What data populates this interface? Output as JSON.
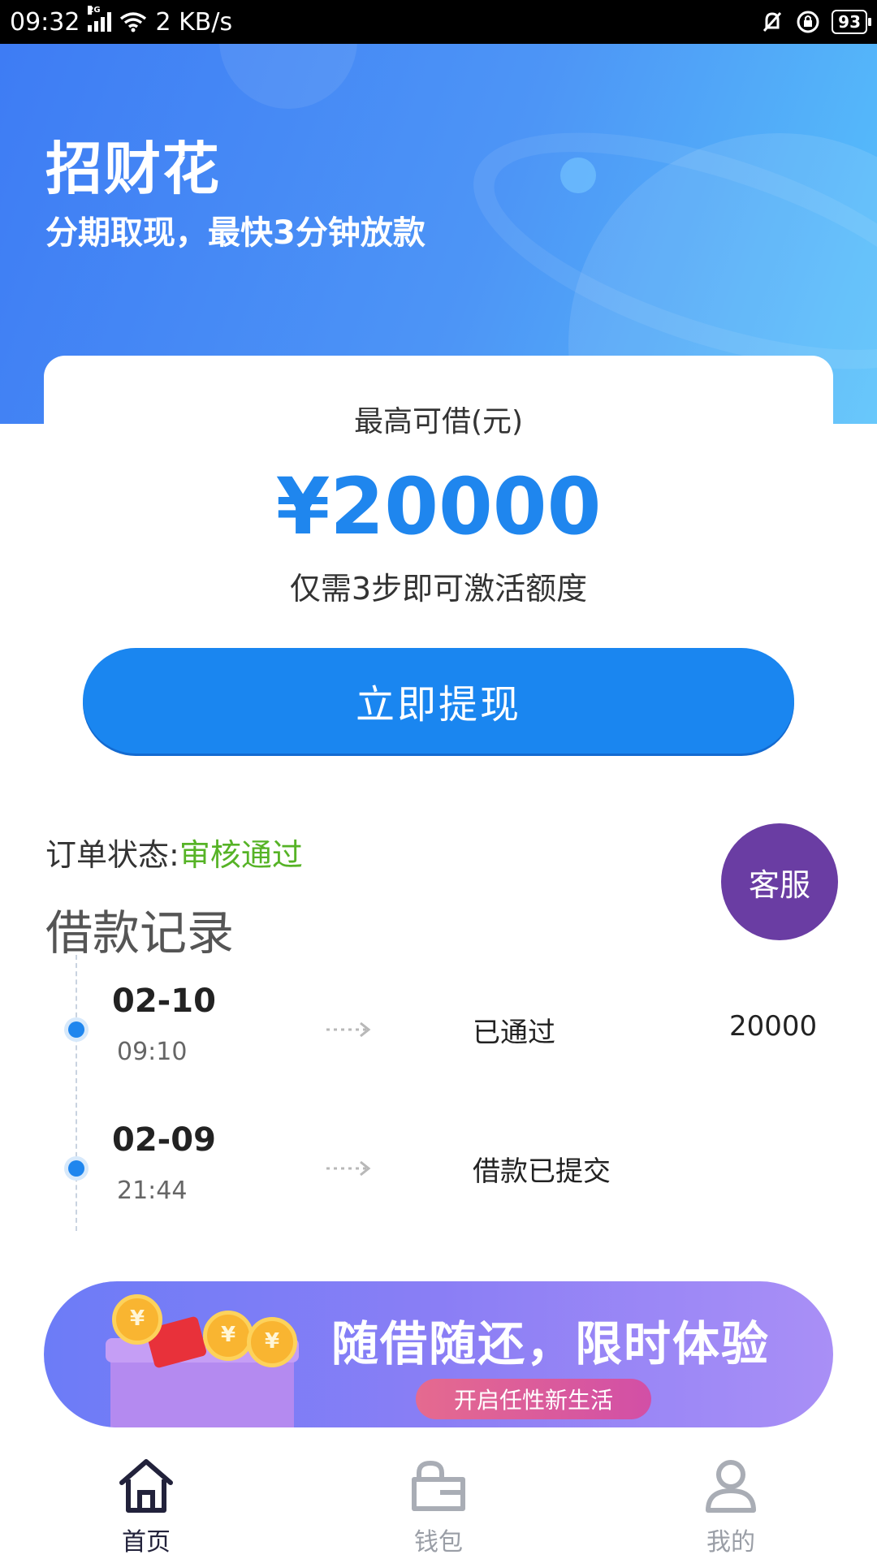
{
  "status_bar": {
    "time": "09:32",
    "network_type": "2G",
    "speed": "2 KB/s",
    "battery": "93",
    "icons": [
      "signal-icon",
      "wifi-icon",
      "mute-icon",
      "rotation-lock-icon",
      "battery-icon"
    ]
  },
  "header": {
    "app_name": "招财花",
    "tagline": "分期取现，最快3分钟放款",
    "colors": {
      "gradient_start": "#3e7cf4",
      "gradient_end": "#57c2fb"
    }
  },
  "loan_card": {
    "label": "最高可借(元)",
    "amount": "¥20000",
    "hint": "仅需3步即可激活额度",
    "cta_label": "立即提现",
    "accent_color": "#1a86f0"
  },
  "order": {
    "status_label": "订单状态:",
    "status_value": "审核通过",
    "status_color": "#56b326"
  },
  "customer_service": {
    "label": "客服",
    "color": "#6a3da3"
  },
  "records": {
    "title": "借款记录",
    "items": [
      {
        "date": "02-10",
        "time": "09:10",
        "status": "已通过",
        "amount": "20000"
      },
      {
        "date": "02-09",
        "time": "21:44",
        "status": "借款已提交",
        "amount": ""
      }
    ]
  },
  "banner": {
    "title": "随借随还，限时体验",
    "subtitle": "开启任性新生活",
    "coin_symbol": "¥"
  },
  "bottom_nav": {
    "items": [
      {
        "label": "首页",
        "icon": "home-icon",
        "active": true
      },
      {
        "label": "钱包",
        "icon": "wallet-icon",
        "active": false
      },
      {
        "label": "我的",
        "icon": "profile-icon",
        "active": false
      }
    ]
  }
}
